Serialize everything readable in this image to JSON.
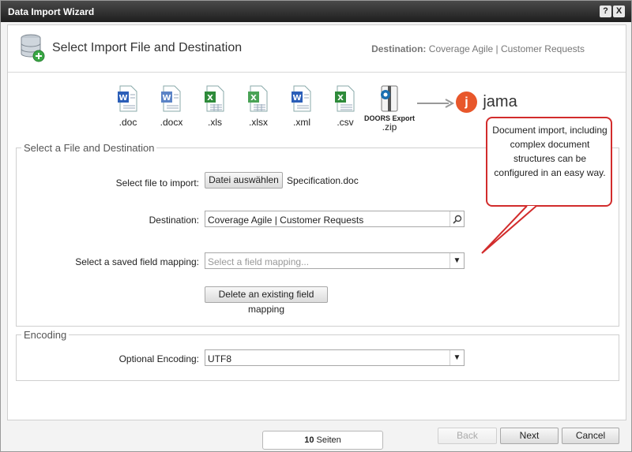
{
  "window": {
    "title": "Data Import Wizard",
    "help_label": "?",
    "close_label": "X"
  },
  "header": {
    "title": "Select Import File and Destination",
    "destination_label": "Destination:",
    "destination_value": "Coverage Agile | Customer Requests"
  },
  "file_types": [
    {
      "label": ".doc",
      "icon": "word-doc-icon",
      "color": "#2b5eb8"
    },
    {
      "label": ".docx",
      "icon": "word-docx-icon",
      "color": "#2b5eb8"
    },
    {
      "label": ".xls",
      "icon": "excel-xls-icon",
      "color": "#2e8b3a"
    },
    {
      "label": ".xlsx",
      "icon": "excel-xlsx-icon",
      "color": "#2e8b3a"
    },
    {
      "label": ".xml",
      "icon": "word-xml-icon",
      "color": "#2b5eb8"
    },
    {
      "label": ".csv",
      "icon": "excel-csv-icon",
      "color": "#2e8b3a"
    },
    {
      "label_top": "DOORS Export",
      "label": ".zip",
      "icon": "doors-zip-icon",
      "color": "#1a6fb0"
    }
  ],
  "jama": {
    "logo_letter": "j",
    "brand": "jama",
    "brand_color": "#e8572b"
  },
  "file_section": {
    "legend": "Select a File and Destination",
    "select_file_label": "Select file to import:",
    "choose_button": "Datei auswählen",
    "chosen_file": "Specification.doc",
    "destination_label": "Destination:",
    "destination_value": "Coverage Agile | Customer Requests",
    "mapping_label": "Select a saved field mapping:",
    "mapping_placeholder": "Select a field mapping...",
    "delete_mapping_button": "Delete an existing field mapping"
  },
  "encoding_section": {
    "legend": "Encoding",
    "encoding_label": "Optional Encoding:",
    "encoding_value": "UTF8"
  },
  "callout": {
    "text": "Document import, including complex document structures can be configured in an easy way.",
    "color": "#d22c2c"
  },
  "footer": {
    "pages_count": "10",
    "pages_word": "Seiten",
    "back_label": "Back",
    "next_label": "Next",
    "cancel_label": "Cancel"
  }
}
